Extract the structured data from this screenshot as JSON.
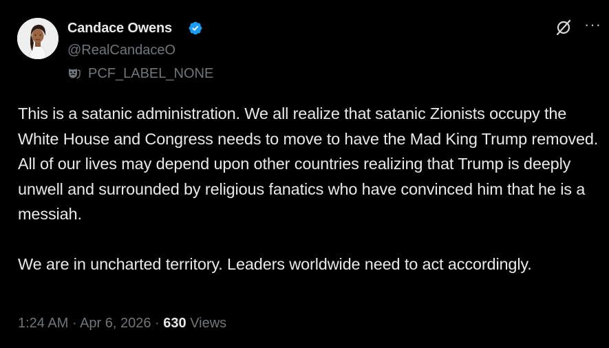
{
  "author": {
    "name": "Candace Owens",
    "handle": "@RealCandaceO",
    "verified": true,
    "verified_color": "#1d9bf0",
    "avatar_icon": "profile-photo"
  },
  "label": {
    "icon": "theater-mask-icon",
    "text": "PCF_LABEL_NONE"
  },
  "header_actions": {
    "grok_icon": "grok-icon",
    "more_icon": "more-icon",
    "more_glyph": "···"
  },
  "tweet": {
    "paragraphs": [
      "This is a satanic administration. We all realize that satanic Zionists occupy the White House and Congress needs to move to have the Mad King Trump removed.",
      "All of our lives may depend upon other countries realizing that Trump is deeply unwell and surrounded by religious fanatics who have convinced him that he is a messiah.",
      "We are in uncharted territory. Leaders worldwide need to act accordingly."
    ]
  },
  "meta": {
    "time": "1:24 AM",
    "separator": " · ",
    "date": "Apr 6, 2026",
    "views_count": "630",
    "views_label": " Views"
  },
  "colors": {
    "background": "#000000",
    "text": "#e7e9ea",
    "secondary": "#71767b",
    "accent": "#1d9bf0"
  }
}
